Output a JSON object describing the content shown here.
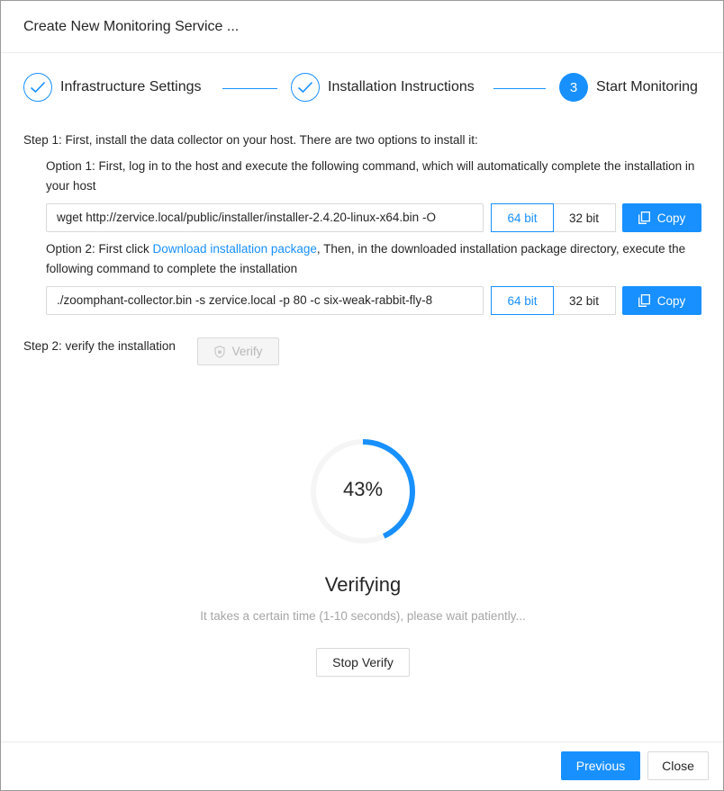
{
  "dialog": {
    "title": "Create New Monitoring Service ..."
  },
  "steps": [
    {
      "label": "Infrastructure Settings",
      "status": "done",
      "icon": "check-icon"
    },
    {
      "label": "Installation Instructions",
      "status": "done",
      "icon": "check-icon"
    },
    {
      "label": "Start Monitoring",
      "status": "active",
      "number": "3"
    }
  ],
  "step1": {
    "intro": "Step 1: First, install the data collector on your host. There are two options to install it:",
    "option1": {
      "text": "Option 1: First, log in to the host and execute the following command, which will automatically complete the installation in your host",
      "command": "wget http://zervice.local/public/installer/installer-2.4.20-linux-x64.bin -O",
      "arch_options": [
        "64 bit",
        "32 bit"
      ],
      "selected_arch": "64 bit",
      "copy_label": "Copy"
    },
    "option2": {
      "text_before": "Option 2: First click ",
      "link": "Download installation package",
      "text_after": ", Then, in the downloaded installation package directory, execute the following command to complete the installation",
      "command": "./zoomphant-collector.bin -s zervice.local -p 80 -c six-weak-rabbit-fly-8",
      "arch_options": [
        "64 bit",
        "32 bit"
      ],
      "selected_arch": "64 bit",
      "copy_label": "Copy"
    }
  },
  "step2": {
    "text": "Step 2: verify the installation",
    "verify_label": "Verify"
  },
  "progress": {
    "percent": 43,
    "label": "43%",
    "color": "#1890ff",
    "track_color": "#f5f5f5"
  },
  "status": {
    "title": "Verifying",
    "subtitle": "It takes a certain time (1-10 seconds), please wait patiently...",
    "stop_label": "Stop Verify"
  },
  "footer": {
    "previous_label": "Previous",
    "close_label": "Close"
  },
  "colors": {
    "accent": "#1890ff",
    "border": "#d9d9d9"
  }
}
